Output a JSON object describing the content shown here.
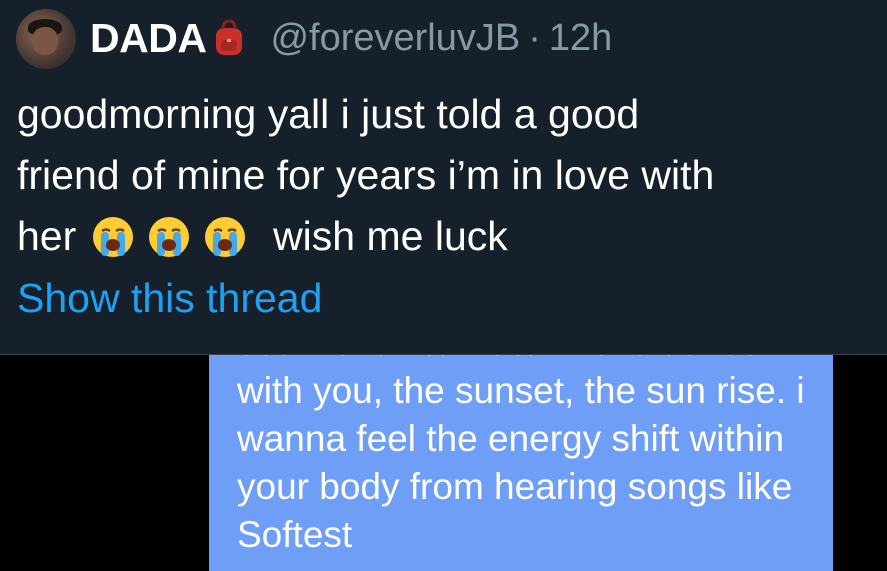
{
  "tweet": {
    "display_name": "DADA",
    "handle": "@foreverluvJB",
    "separator": "·",
    "timestamp": "12h",
    "name_emoji": "backpack-icon",
    "text_line1": "goodmorning yall i just told a good",
    "text_line2": "friend of mine for years i’m in love with",
    "text_line3_start": "her",
    "text_emoji": [
      "loudly-crying-face",
      "loudly-crying-face",
      "loudly-crying-face"
    ],
    "text_line3_end": "wish me luck",
    "show_thread": "Show this thread"
  },
  "media": {
    "message_text": "soul. id luv to watch Love Jones with you, the sunset, the sun rise. i wanna feel the energy shift within your body from hearing songs like Softest",
    "bubble_color": "#6f9ef7"
  },
  "colors": {
    "background": "#15202b",
    "link": "#1da1f2",
    "secondary": "#8899a6"
  }
}
